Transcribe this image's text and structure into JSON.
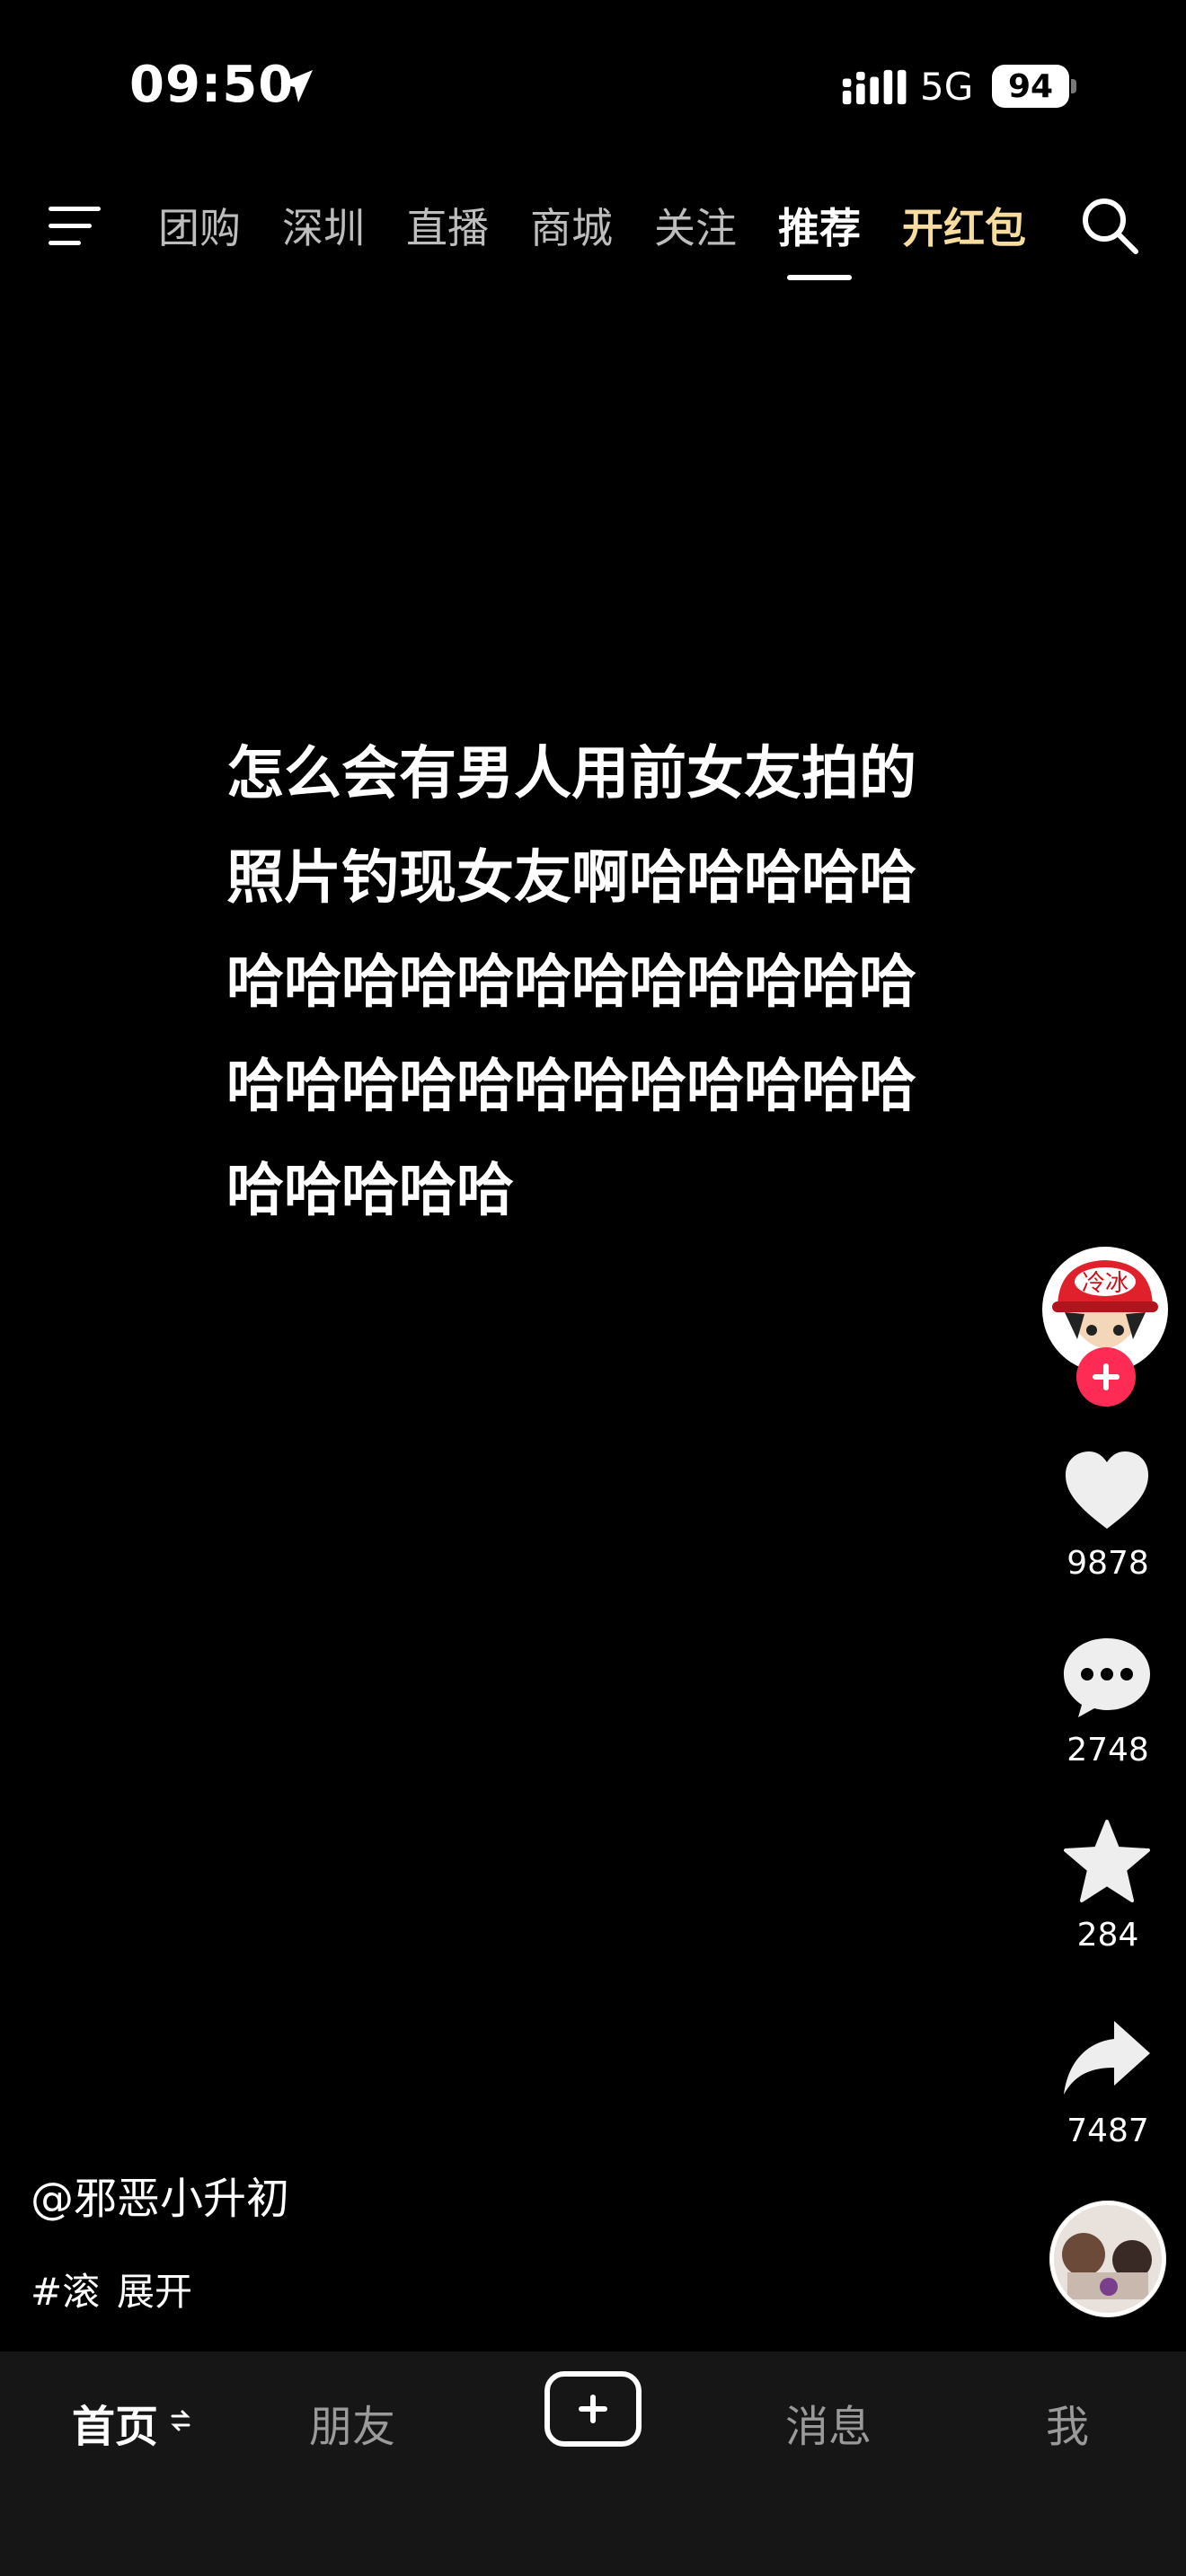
{
  "status_bar": {
    "time": "09:50",
    "network": "5G",
    "battery": "94"
  },
  "top_nav": {
    "tabs": [
      {
        "label": "团购"
      },
      {
        "label": "深圳"
      },
      {
        "label": "直播"
      },
      {
        "label": "商城"
      },
      {
        "label": "关注"
      },
      {
        "label": "推荐",
        "active": true
      },
      {
        "label": "开红包",
        "promo": true
      }
    ]
  },
  "post": {
    "text": "怎么会有男人用前女友拍的照片钓现女友啊哈哈哈哈哈哈哈哈哈哈哈哈哈哈哈哈哈哈哈哈哈哈哈哈哈哈哈哈哈哈哈哈哈哈"
  },
  "avatar": {
    "badge_text": "冷冰"
  },
  "actions": {
    "likes": "9878",
    "comments": "2748",
    "favorites": "284",
    "shares": "7487"
  },
  "caption": {
    "author": "@邪恶小升初",
    "hashtag": "#滚",
    "expand": "展开"
  },
  "bottom_nav": {
    "home": "首页",
    "friends": "朋友",
    "messages": "消息",
    "me": "我"
  },
  "colors": {
    "background": "#000000",
    "promo": "#f6dc9e",
    "follow": "#fe2c55",
    "bottom_bar": "#161616"
  }
}
